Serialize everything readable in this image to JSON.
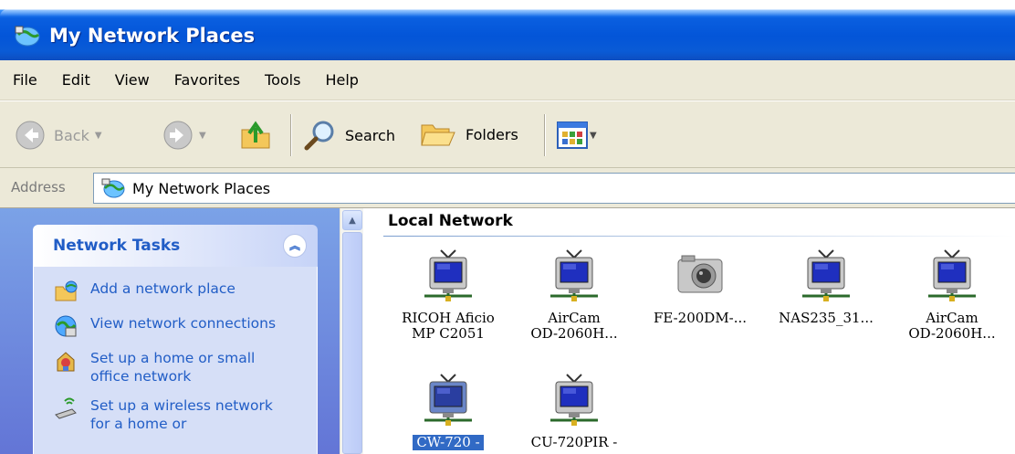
{
  "window": {
    "title": "My Network Places"
  },
  "menu": {
    "items": [
      "File",
      "Edit",
      "View",
      "Favorites",
      "Tools",
      "Help"
    ]
  },
  "toolbar": {
    "back_label": "Back",
    "search_label": "Search",
    "folders_label": "Folders"
  },
  "address": {
    "label": "Address",
    "value": "My Network Places"
  },
  "tasks": {
    "header": "Network Tasks",
    "items": [
      {
        "label": "Add a network place",
        "icon": "add-network-place-icon"
      },
      {
        "label": "View network connections",
        "icon": "view-network-connections-icon"
      },
      {
        "label": "Set up a home or small office network",
        "icon": "home-network-setup-icon"
      },
      {
        "label": "Set up a wireless network for a home or",
        "icon": "wireless-network-setup-icon"
      }
    ]
  },
  "content": {
    "group_title": "Local Network",
    "devices": [
      {
        "label": "RICOH Aficio\nMP C2051",
        "icon": "network-device-tv-icon",
        "selected": false
      },
      {
        "label": "AirCam\nOD-2060H...",
        "icon": "network-device-tv-icon",
        "selected": false
      },
      {
        "label": "FE-200DM-...",
        "icon": "camera-icon",
        "selected": false
      },
      {
        "label": "NAS235_31...",
        "icon": "network-device-tv-icon",
        "selected": false
      },
      {
        "label": "AirCam\nOD-2060H...",
        "icon": "network-device-tv-icon",
        "selected": false
      },
      {
        "label": "CW-720 -",
        "icon": "network-device-tv-icon",
        "selected": true
      },
      {
        "label": "CU-720PIR -",
        "icon": "network-device-tv-icon",
        "selected": false
      }
    ]
  },
  "colors": {
    "titlebar_blue": "#0355d8",
    "task_pane_blue": "#6f8fe0",
    "task_link": "#215dc6",
    "selection": "#316ac5"
  }
}
